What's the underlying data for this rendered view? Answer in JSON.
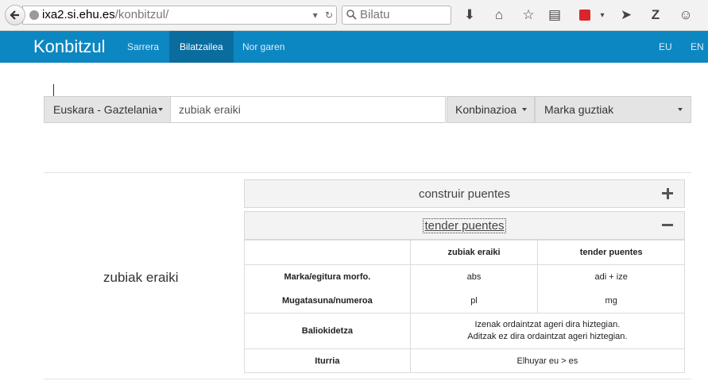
{
  "browser": {
    "url_host": "ixa2.si.ehu.es",
    "url_path": "/konbitzul/",
    "search_placeholder": "Bilatu"
  },
  "navbar": {
    "brand": "Konbitzul",
    "links": [
      "Sarrera",
      "Bilatzailea",
      "Nor garen"
    ],
    "active": "Bilatzailea",
    "langs": [
      "EU",
      "EN"
    ]
  },
  "search": {
    "language_pair": "Euskara - Gaztelania",
    "query": "zubiak eraiki",
    "mode": "Konbinazioa",
    "mark_filter": "Marka guztiak"
  },
  "result": {
    "term": "zubiak eraiki",
    "translations": [
      {
        "label": "construir puentes",
        "expanded": false
      },
      {
        "label": "tender puentes",
        "expanded": true
      }
    ],
    "table": {
      "col_headers": [
        "zubiak eraiki",
        "tender puentes"
      ],
      "rows": [
        {
          "label": "Marka/egitura morfo.",
          "eu": "abs",
          "es": "adi + ize"
        },
        {
          "label": "Mugatasuna/numeroa",
          "eu": "pl",
          "es": "mg"
        }
      ],
      "equivalence_label": "Baliokidetza",
      "equivalence_lines": [
        "Izenak ordaintzat ageri dira hiztegian.",
        "Aditzak ez dira ordaintzat ageri hiztegian."
      ],
      "source_label": "Iturria",
      "source_value": "Elhuyar eu > es"
    }
  },
  "colors": {
    "navbar": "#0d87c2",
    "navbar_active": "#0a6d9e"
  }
}
